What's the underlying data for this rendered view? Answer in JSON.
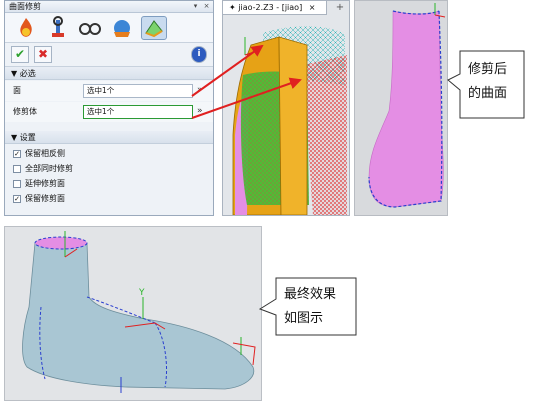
{
  "panel": {
    "title": "曲面修剪",
    "toolbar_icons": [
      "flame-icon",
      "wrench-icon",
      "goggles-icon",
      "globe-tool-icon",
      "surface-trim-icon"
    ],
    "ok_label": "✔",
    "cancel_label": "✖",
    "info_label": "i",
    "required_section": "必选",
    "face_label": "面",
    "face_value": "选中1个",
    "trim_body_label": "修剪体",
    "trim_body_value": "选中1个",
    "settings_section": "设置",
    "options": [
      {
        "label": "保留相反侧",
        "checked": true
      },
      {
        "label": "全部同时修剪",
        "checked": false
      },
      {
        "label": "延伸修剪面",
        "checked": false
      },
      {
        "label": "保留修剪面",
        "checked": true
      }
    ]
  },
  "viewport": {
    "tab_label": "jiao-2.Z3 - [jiao]",
    "tab_close": "×",
    "add_tab": "+"
  },
  "callouts": {
    "trimmed": [
      "修剪后",
      "的曲面"
    ],
    "final": [
      "最终效果",
      "如图示"
    ]
  },
  "colors": {
    "magenta_surface": "#e48ee4",
    "green_surface": "#3ec23a",
    "orange_trim_body": "#e6a216",
    "red_mesh": "#e23b3b",
    "blue_curve": "#2a3fcf",
    "foot_surface": "#a9c6d3",
    "arrow_red": "#e02020"
  }
}
